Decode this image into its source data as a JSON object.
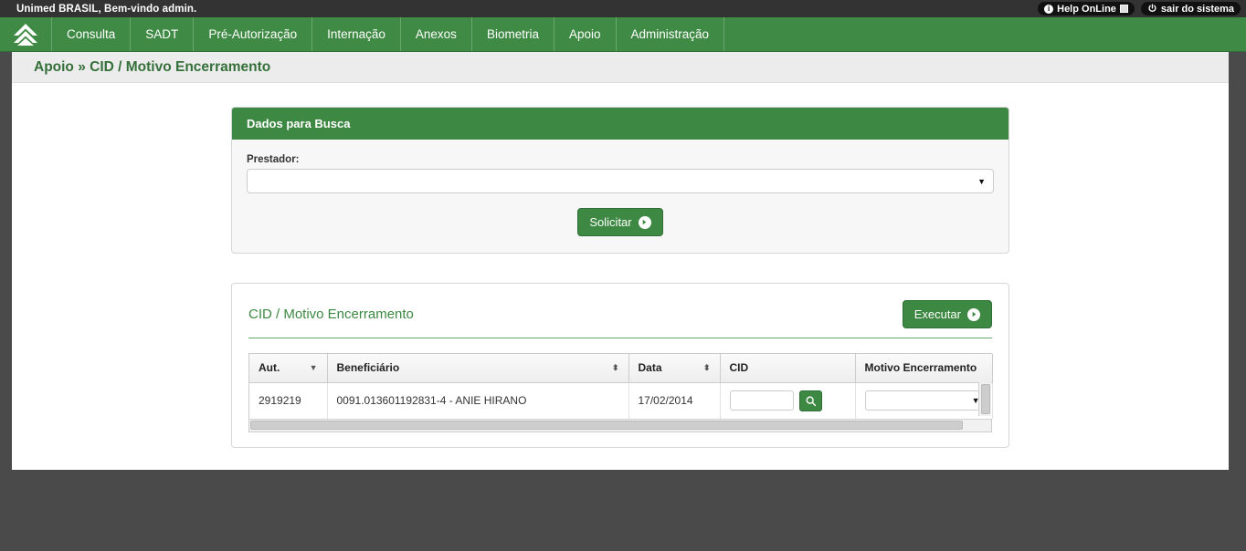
{
  "topbar": {
    "greeting": "Unimed BRASIL, Bem-vindo admin.",
    "help_label": "Help OnLine",
    "logout_label": "sair do sistema",
    "help_icon": "info-icon",
    "help_box_icon": "checkbox-icon",
    "logout_icon": "power-icon"
  },
  "nav": {
    "logo_icon": "unimed-logo-icon",
    "items": [
      {
        "label": "Consulta"
      },
      {
        "label": "SADT"
      },
      {
        "label": "Pré-Autorização"
      },
      {
        "label": "Internação"
      },
      {
        "label": "Anexos"
      },
      {
        "label": "Biometria"
      },
      {
        "label": "Apoio"
      },
      {
        "label": "Administração"
      }
    ]
  },
  "breadcrumb": {
    "text": "Apoio » CID / Motivo Encerramento"
  },
  "search_panel": {
    "title": "Dados para Busca",
    "prestador_label": "Prestador:",
    "prestador_value": "",
    "caret_icon": "chevron-down-icon",
    "submit_label": "Solicitar",
    "submit_icon": "arrow-right-circle-icon"
  },
  "results_panel": {
    "title": "CID / Motivo Encerramento",
    "execute_label": "Executar",
    "execute_icon": "arrow-right-circle-icon",
    "columns": [
      {
        "label": "Aut.",
        "sort": "desc",
        "sort_icon": "caret-down-icon"
      },
      {
        "label": "Beneficiário",
        "sort": "none",
        "sort_icon": "sort-updown-icon"
      },
      {
        "label": "Data",
        "sort": "none",
        "sort_icon": "sort-updown-icon"
      },
      {
        "label": "CID",
        "sort": null,
        "sort_icon": ""
      },
      {
        "label": "Motivo Encerramento",
        "sort": null,
        "sort_icon": ""
      }
    ],
    "rows": [
      {
        "aut": "2919219",
        "beneficiario": "0091.013601192831-4 - ANIE HIRANO",
        "data": "17/02/2014",
        "cid_value": "",
        "cid_search_icon": "magnifier-icon",
        "motivo_value": "",
        "motivo_caret_icon": "chevron-down-icon"
      }
    ]
  },
  "colors": {
    "brand_green": "#3d8842",
    "nav_green": "#3f8a44",
    "topbar_dark": "#333333",
    "page_bg": "#4a4a4a",
    "breadcrumb_bg": "#ececec"
  }
}
